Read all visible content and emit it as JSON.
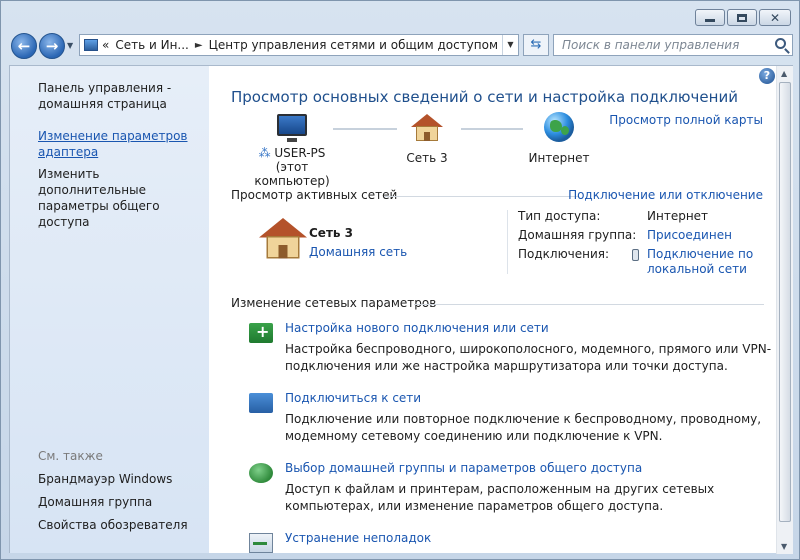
{
  "address": {
    "breadcrumb_overflow": "«",
    "crumb1": "Сеть и Ин...",
    "crumb2": "Центр управления сетями и общим доступом",
    "search_placeholder": "Поиск в панели управления"
  },
  "sidebar": {
    "home": "Панель управления - домашняя страница",
    "adapter": "Изменение параметров адаптера",
    "sharing": "Изменить дополнительные параметры общего доступа",
    "see_also": "См. также",
    "firewall": "Брандмауэр Windows",
    "homegroup": "Домашняя группа",
    "browser": "Свойства обозревателя"
  },
  "main": {
    "title": "Просмотр основных сведений о сети и настройка подключений",
    "full_map": "Просмотр полной карты",
    "map": {
      "computer_name": "USER-PS",
      "computer_note": "(этот компьютер)",
      "network": "Сеть  3",
      "internet": "Интернет"
    },
    "active_header": "Просмотр активных сетей",
    "connect_disconnect": "Подключение или отключение",
    "active_network": {
      "name": "Сеть  3",
      "type": "Домашняя сеть",
      "access_label": "Тип доступа:",
      "access_value": "Интернет",
      "homegroup_label": "Домашняя группа:",
      "homegroup_value": "Присоединен",
      "connections_label": "Подключения:",
      "connections_value": "Подключение по локальной сети"
    },
    "change_header": "Изменение сетевых параметров",
    "tasks": [
      {
        "link": "Настройка нового подключения или сети",
        "desc": "Настройка беспроводного, широкополосного, модемного, прямого или VPN-подключения или же настройка маршрутизатора или точки доступа."
      },
      {
        "link": "Подключиться к сети",
        "desc": "Подключение или повторное подключение к беспроводному, проводному, модемному сетевому соединению или подключение к VPN."
      },
      {
        "link": "Выбор домашней группы и параметров общего доступа",
        "desc": "Доступ к файлам и принтерам, расположенным на других сетевых компьютерах, или изменение параметров общего доступа."
      },
      {
        "link": "Устранение неполадок",
        "desc": ""
      }
    ]
  }
}
